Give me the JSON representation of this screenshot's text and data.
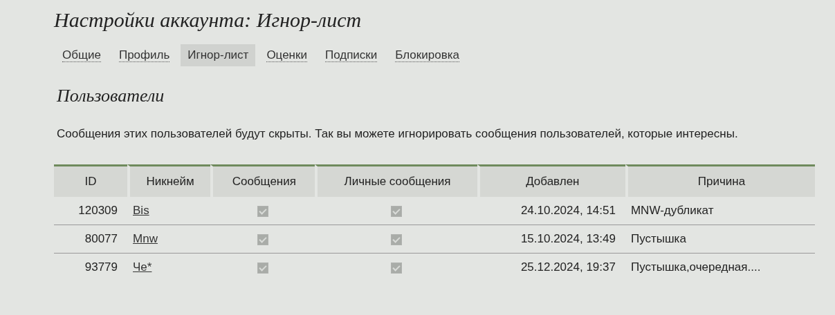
{
  "title": "Настройки аккаунта: Игнор-лист",
  "tabs": [
    {
      "label": "Общие",
      "selected": false
    },
    {
      "label": "Профиль",
      "selected": false
    },
    {
      "label": "Игнор-лист",
      "selected": true
    },
    {
      "label": "Оценки",
      "selected": false
    },
    {
      "label": "Подписки",
      "selected": false
    },
    {
      "label": "Блокировка",
      "selected": false
    }
  ],
  "section_title": "Пользователи",
  "description": "Сообщения этих пользователей будут скрыты. Так вы можете игнорировать сообщения пользователей, которые интересны.",
  "table": {
    "columns": [
      "ID",
      "Никнейм",
      "Сообщения",
      "Личные сообщения",
      "Добавлен",
      "Причина"
    ],
    "rows": [
      {
        "id": "120309",
        "nickname": "Bis",
        "messages_checked": true,
        "private_checked": true,
        "added": "24.10.2024, 14:51",
        "reason": "MNW-дубликат"
      },
      {
        "id": "80077",
        "nickname": "Mnw",
        "messages_checked": true,
        "private_checked": true,
        "added": "15.10.2024, 13:49",
        "reason": "Пустышка"
      },
      {
        "id": "93779",
        "nickname": "Че*",
        "messages_checked": true,
        "private_checked": true,
        "added": "25.12.2024, 19:37",
        "reason": "Пустышка,очередная...."
      }
    ]
  }
}
